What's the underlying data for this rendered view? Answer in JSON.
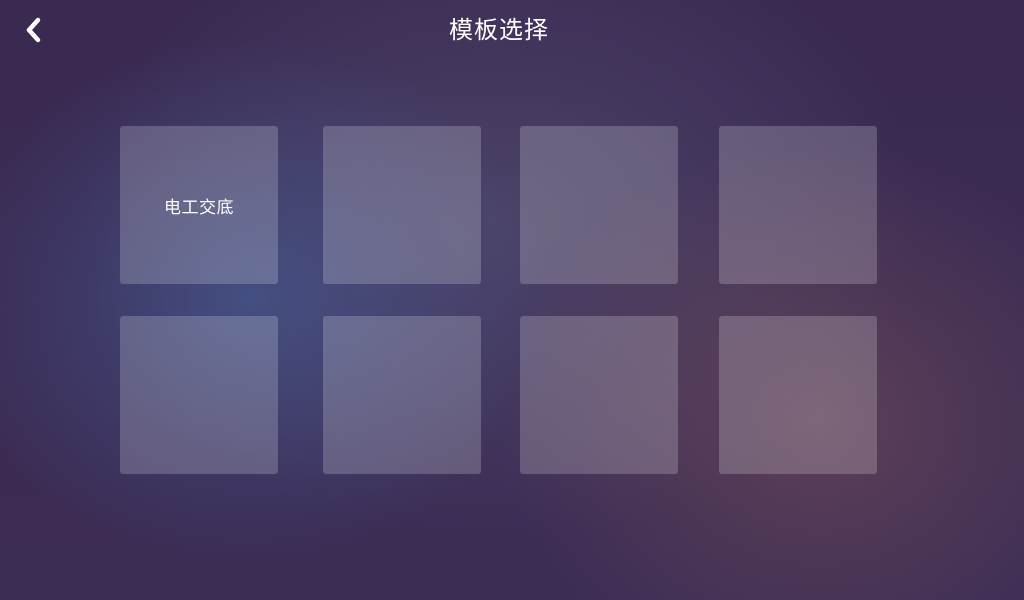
{
  "header": {
    "title": "模板选择",
    "back_icon": "chevron-left-icon"
  },
  "templates": [
    {
      "label": "电工交底"
    },
    {
      "label": ""
    },
    {
      "label": ""
    },
    {
      "label": ""
    },
    {
      "label": ""
    },
    {
      "label": ""
    },
    {
      "label": ""
    },
    {
      "label": ""
    }
  ],
  "colors": {
    "background_base": "#3a2a52",
    "tile_fill": "rgba(255,255,255,0.2)",
    "text": "#ffffff"
  }
}
